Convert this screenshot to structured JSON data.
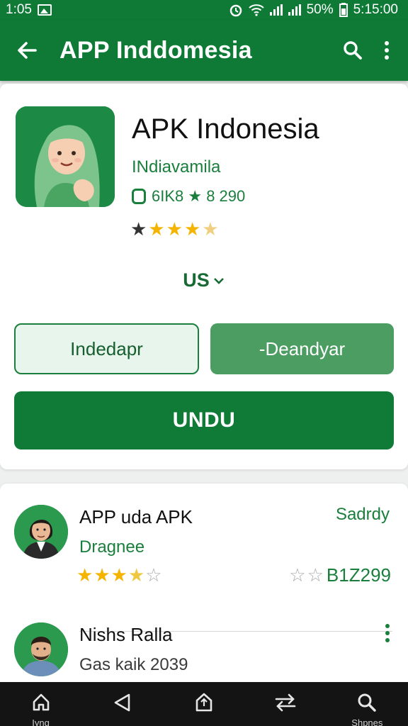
{
  "status_bar": {
    "time_left": "1:05",
    "battery_text": "50%",
    "time_right": "5:15:00"
  },
  "app_bar": {
    "title": "APP Inddomesia",
    "back_icon": "arrow-left-icon",
    "search_icon": "search-icon",
    "more_icon": "more-vertical-icon",
    "color": "#0e7a36"
  },
  "app_card": {
    "name": "APK Indonesia",
    "developer": "INdiavamila",
    "meta": "6IK8 ★ 8 290",
    "rating": 3.5,
    "region": "US",
    "button_left": "Indedapr",
    "button_right": "-Deandyar",
    "primary_button": "UNDU"
  },
  "list": {
    "items": [
      {
        "title": "APP uda APK",
        "subtitle": "Dragnee",
        "action": "Sadrdy",
        "stars": 3.5,
        "rating_value": "B1Z299"
      },
      {
        "title": "Nishs Ralla",
        "subtitle": "Gas kaik 2039",
        "action_icon": "more-vertical-icon"
      }
    ]
  },
  "nav_bar": {
    "home_label": "Iyng",
    "share_label": "Shpnes",
    "icons": [
      "home-icon",
      "back-triangle-icon",
      "upload-icon",
      "swap-icon",
      "search-icon"
    ]
  }
}
